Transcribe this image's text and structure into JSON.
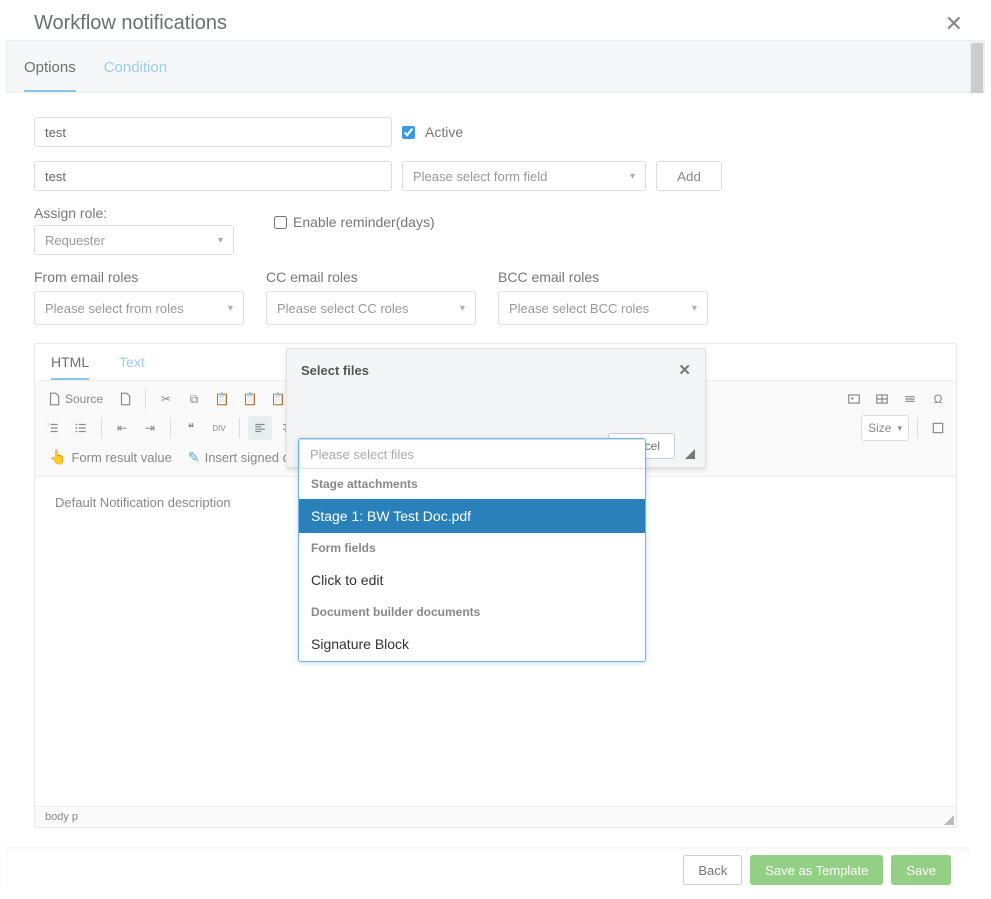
{
  "header": {
    "title": "Workflow notifications"
  },
  "tabs": {
    "options": "Options",
    "condition": "Condition"
  },
  "form": {
    "name_value": "test",
    "active_label": "Active",
    "active_checked": true,
    "subject_value": "test",
    "form_field_placeholder": "Please select form field",
    "add_label": "Add",
    "assign_role_label": "Assign role:",
    "assign_role_value": "Requester",
    "enable_reminder_label": "Enable reminder(days)",
    "enable_reminder_checked": false,
    "roles": {
      "from_label": "From email roles",
      "from_placeholder": "Please select from roles",
      "cc_label": "CC email roles",
      "cc_placeholder": "Please select CC roles",
      "bcc_label": "BCC email roles",
      "bcc_placeholder": "Please select BCC roles"
    }
  },
  "editor": {
    "tabs": {
      "html": "HTML",
      "text": "Text"
    },
    "source_label": "Source",
    "size_label": "Size",
    "form_result_label": "Form result value",
    "insert_signed_label": "Insert signed d",
    "default_text": "Default Notification description",
    "path": "body   p"
  },
  "popup": {
    "title": "Select files",
    "cancel_label": "Cancel"
  },
  "dropdown": {
    "placeholder": "Please select files",
    "groups": [
      {
        "label": "Stage attachments",
        "items": [
          "Stage 1: BW Test Doc.pdf"
        ]
      },
      {
        "label": "Form fields",
        "items": [
          "Click to edit"
        ]
      },
      {
        "label": "Document builder documents",
        "items": [
          "Signature Block"
        ]
      }
    ],
    "selected": "Stage 1: BW Test Doc.pdf"
  },
  "footer": {
    "back": "Back",
    "save_as_template": "Save as Template",
    "save": "Save"
  }
}
